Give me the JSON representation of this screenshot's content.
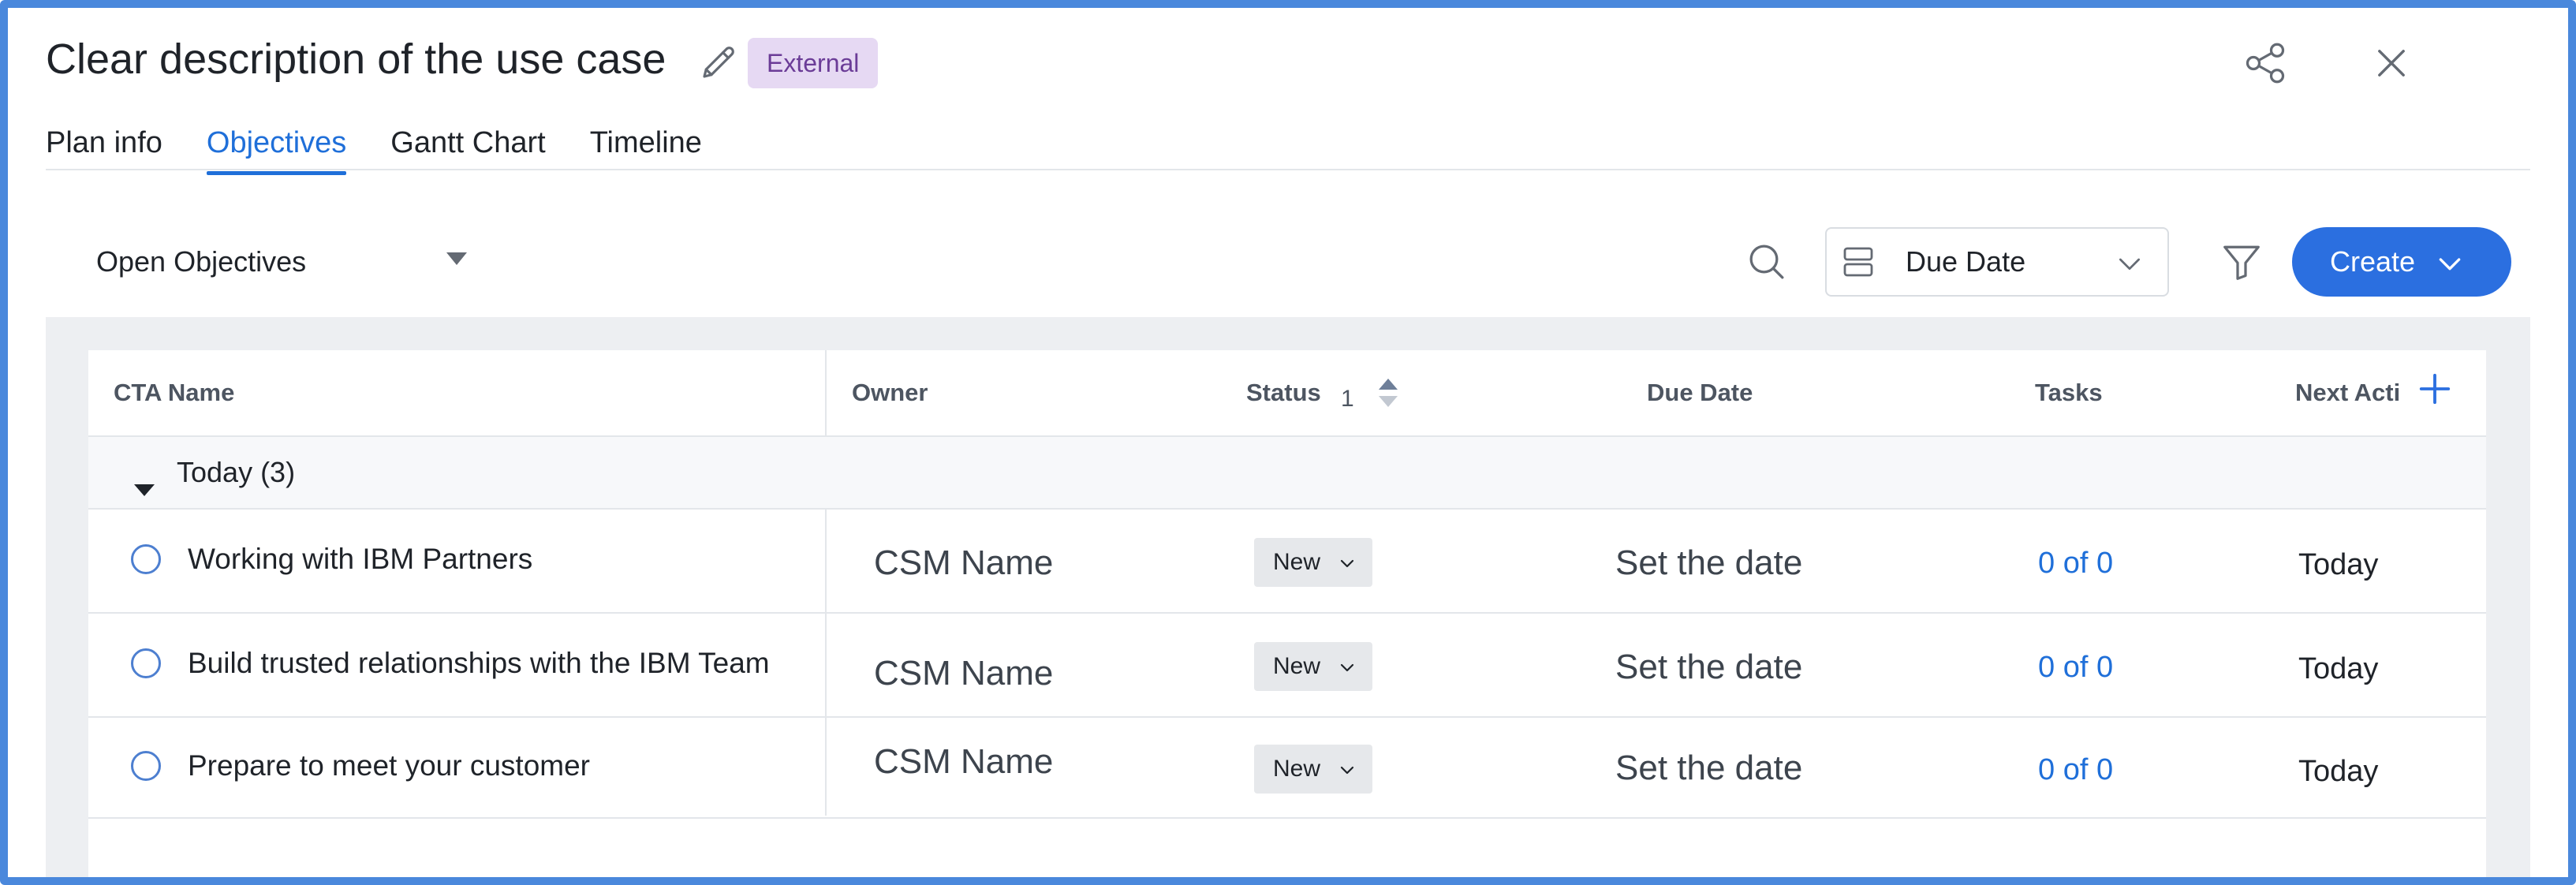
{
  "header": {
    "title": "Clear description of the use case",
    "badge": "External",
    "icons": [
      "pencil-icon",
      "share-icon",
      "close-icon"
    ]
  },
  "tabs": [
    {
      "label": "Plan info",
      "active": false
    },
    {
      "label": "Objectives",
      "active": true
    },
    {
      "label": "Gantt Chart",
      "active": false
    },
    {
      "label": "Timeline",
      "active": false
    }
  ],
  "toolbar": {
    "view_selected": "Open Objectives",
    "sort_by": "Due Date",
    "create_label": "Create"
  },
  "table": {
    "columns": [
      "CTA Name",
      "Owner",
      "Status",
      "Due Date",
      "Tasks",
      "Next Acti"
    ],
    "status_sort_count": "1",
    "group": {
      "label": "Today (3)",
      "expanded": true
    },
    "rows": [
      {
        "name": "Working with IBM Partners",
        "owner": "CSM Name",
        "status": "New",
        "due": "Set the date",
        "tasks": "0 of 0",
        "next": "Today"
      },
      {
        "name": "Build trusted relationships with the IBM Team",
        "owner": "CSM Name",
        "status": "New",
        "due": "Set the date",
        "tasks": "0 of 0",
        "next": "Today"
      },
      {
        "name": "Prepare to meet your customer",
        "owner": "CSM Name",
        "status": "New",
        "due": "Set the date",
        "tasks": "0 of 0",
        "next": "Today"
      }
    ]
  },
  "colors": {
    "accent": "#2b6fe0",
    "frame": "#4a88dc",
    "badge_bg": "#e6d9f3",
    "badge_text": "#6b3c97",
    "link": "#1f6fd9"
  }
}
